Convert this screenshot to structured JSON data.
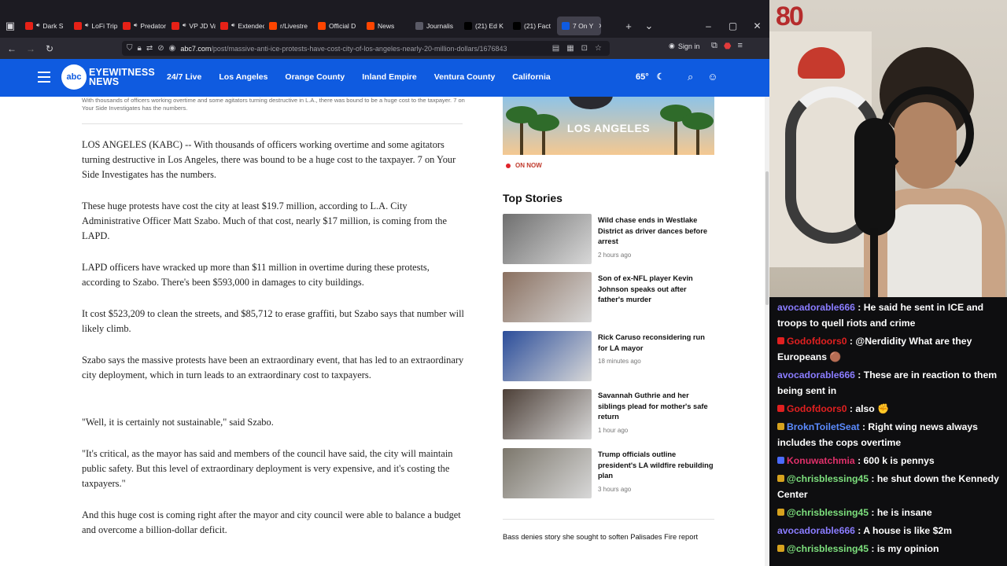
{
  "browser": {
    "tabs": [
      {
        "label": "Dark S",
        "color": "#e62117"
      },
      {
        "label": "LoFi Tripl",
        "color": "#e62117"
      },
      {
        "label": "Predator",
        "color": "#e62117"
      },
      {
        "label": "VP JD Va",
        "color": "#e62117"
      },
      {
        "label": "Extendec",
        "color": "#e62117"
      },
      {
        "label": "r/Livestre",
        "color": "#ff4500"
      },
      {
        "label": "Official D",
        "color": "#ff4500"
      },
      {
        "label": "News",
        "color": "#ff4500"
      },
      {
        "label": "Journalis",
        "color": "#5a5a66"
      },
      {
        "label": "(21) Ed K",
        "color": "#000000"
      },
      {
        "label": "(21) Fact",
        "color": "#000000"
      },
      {
        "label": "7 On Y",
        "color": "#0f5be0",
        "active": true
      }
    ],
    "url_domain": "abc7.com",
    "url_path": "/post/massive-anti-ice-protests-have-cost-city-of-los-angeles-nearly-20-million-dollars/1676843",
    "sign_in": "Sign in"
  },
  "site": {
    "logo_letters": "abc",
    "logo_line1": "EYEWITNESS",
    "logo_line2": "NEWS",
    "nav": [
      "24/7 Live",
      "Los Angeles",
      "Orange County",
      "Inland Empire",
      "Ventura County",
      "California"
    ],
    "temperature": "65°"
  },
  "article": {
    "caption": "With thousands of officers working overtime and some agitators turning destructive in L.A., there was bound to be a huge cost to the taxpayer. 7 on Your Side Investigates has the numbers.",
    "paragraphs": [
      "LOS ANGELES (KABC) -- With thousands of officers working overtime and some agitators turning destructive in Los Angeles, there was bound to be a huge cost to the taxpayer. 7 on Your Side Investigates has the numbers.",
      "These huge protests have cost the city at least $19.7 million, according to L.A. City Administrative Officer Matt Szabo. Much of that cost, nearly $17 million, is coming from the LAPD.",
      "LAPD officers have wracked up more than $11 million in overtime during these protests, according to Szabo. There's been $593,000 in damages to city buildings.",
      "It cost $523,209 to clean the streets, and $85,712 to erase graffiti, but Szabo says that number will likely climb.",
      "Szabo says the massive protests have been an extraordinary event, that has led to an extraordinary city deployment, which in turn leads to an extraordinary cost to taxpayers.",
      "\"Well, it is certainly not sustainable,\" said Szabo.",
      "\"It's critical, as the mayor has said and members of the council have said, the city will maintain public safety. But this level of extraordinary deployment is very expensive, and it's costing the taxpayers.\"",
      "And this huge cost is coming right after the mayor and city council were able to balance a budget and overcome a billion-dollar deficit."
    ]
  },
  "sidebar": {
    "hero_title": "LOS ANGELES",
    "on_now": "ON NOW",
    "top_stories_heading": "Top Stories",
    "stories": [
      {
        "title": "Wild chase ends in Westlake District as driver dances before arrest",
        "time": "2 hours ago",
        "thumb": "#6f6f6f"
      },
      {
        "title": "Son of ex-NFL player Kevin Johnson speaks out after father's murder",
        "time": "",
        "thumb": "#8a7060"
      },
      {
        "title": "Rick Caruso reconsidering run for LA mayor",
        "time": "18 minutes ago",
        "thumb": "#2b4d9a"
      },
      {
        "title": "Savannah Guthrie and her siblings plead for mother's safe return",
        "time": "1 hour ago",
        "thumb": "#4d4038"
      },
      {
        "title": "Trump officials outline president's LA wildfire rebuilding plan",
        "time": "3 hours ago",
        "thumb": "#7c776c"
      }
    ],
    "bottom_story": "Bass denies story she sought to soften Palisades Fire report"
  },
  "chat": [
    {
      "user": "avocadorable666",
      "text": " : He said he sent in ICE and troops to quell riots and crime",
      "color": "#8a7cff",
      "badge": ""
    },
    {
      "user": "Godofdoors0",
      "text": " : @Nerdidity What are they Europeans 🟤",
      "color": "#e02020",
      "badge": "red"
    },
    {
      "user": "avocadorable666",
      "text": " : These are in reaction to them being sent in",
      "color": "#8a7cff",
      "badge": ""
    },
    {
      "user": "Godofdoors0",
      "text": " : also ✊",
      "color": "#e02020",
      "badge": "red"
    },
    {
      "user": "BroknToiletSeat",
      "text": " : Right wing news always includes the cops overtime",
      "color": "#5b8bff",
      "badge": "gold"
    },
    {
      "user": "Konuwatchmia",
      "text": " : 600 k is pennys",
      "color": "#e0306a",
      "badge": "blue"
    },
    {
      "user": "@chrisblessing45",
      "text": " : he shut down the Kennedy Center",
      "color": "#7de07d",
      "badge": "gold"
    },
    {
      "user": "@chrisblessing45",
      "text": " : he is insane",
      "color": "#7de07d",
      "badge": "gold"
    },
    {
      "user": "avocadorable666",
      "text": " : A house is like $2m",
      "color": "#8a7cff",
      "badge": ""
    },
    {
      "user": "@chrisblessing45",
      "text": " : is my opinion",
      "color": "#7de07d",
      "badge": "gold"
    }
  ]
}
